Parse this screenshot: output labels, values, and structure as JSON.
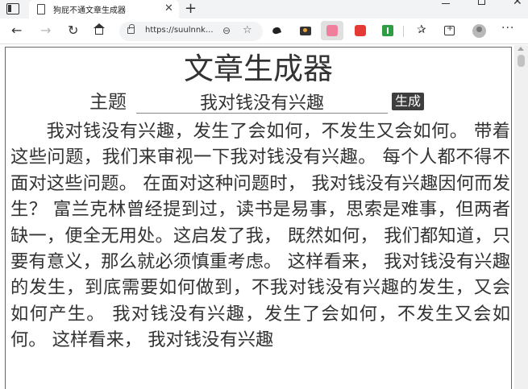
{
  "browser": {
    "tab_title": "狗屁不通文章生成器",
    "tab_close_glyph": "✕",
    "new_tab_glyph": "+",
    "window_minimize_glyph": "",
    "window_close_glyph": "✕",
    "url": "https://suulnnk...",
    "icons": [
      "tab-actions-icon",
      "page-icon",
      "close-icon",
      "plus-icon",
      "back-icon",
      "forward-icon",
      "reload-icon",
      "home-icon",
      "lock-icon",
      "zoom-icon",
      "add-favorite-icon",
      "extension-icon",
      "favorites-icon",
      "collections-icon",
      "profile-icon",
      "more-icon"
    ]
  },
  "page": {
    "title": "文章生成器",
    "subject_label": "主题",
    "subject_value": "我对钱没有兴趣",
    "generate_label": "生成",
    "article": "我对钱没有兴趣，发生了会如何，不发生又会如何。 带着这些问题，我们来审视一下我对钱没有兴趣。 每个人都不得不面对这些问题。 在面对这种问题时， 我对钱没有兴趣因何而发生？ 富兰克林曾经提到过，读书是易事，思索是难事，但两者缺一，便全无用处。这启发了我， 既然如何， 我们都知道，只要有意义，那么就必须慎重考虑。 这样看来， 我对钱没有兴趣的发生，到底需要如何做到，不我对钱没有兴趣的发生，又会如何产生。 我对钱没有兴趣，发生了会如何，不发生又会如何。 这样看来， 我对钱没有兴趣"
  }
}
